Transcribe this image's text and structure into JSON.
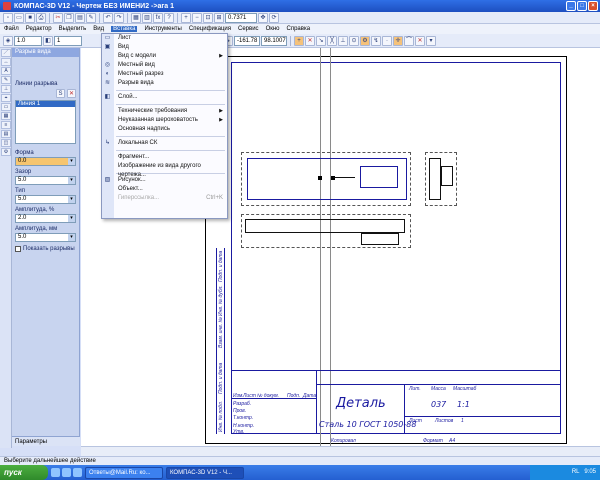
{
  "window": {
    "title": "КОМПАС-3D V12 - Чертеж БЕЗ ИМЕНИ2 ->ага 1"
  },
  "menubar": [
    "Файл",
    "Редактор",
    "Выделить",
    "Вид",
    "Вставка",
    "Инструменты",
    "Спецификация",
    "Сервис",
    "Окно",
    "Справка"
  ],
  "toolbar": {
    "zoom": "0.7371",
    "coord_x": "-161.78",
    "coord_y": "98.1007",
    "scale": "1.0",
    "layer": "1"
  },
  "panel": {
    "title": "Разрыв вида",
    "list_title": "Линии разрыва",
    "list_items": [
      "Линия 1"
    ],
    "form_label": "Форма",
    "form_value": "0.0",
    "gap_label": "Зазор",
    "gap_value": "5.0",
    "type_label": "Тип",
    "type_value": "5.0",
    "amp_label": "Амплитуда, %",
    "amp_value": "2.0",
    "amp_max_label": "Амплитуда, мм",
    "amp_max_value": "5.0",
    "show_label": "Показать разрывы",
    "tab_label": "Параметры"
  },
  "menu": {
    "items": [
      {
        "label": "Лист",
        "icon": "sheet-icon"
      },
      {
        "label": "Вид",
        "icon": "view-icon"
      },
      {
        "label": "Вид с модели",
        "icon": "",
        "submenu": true
      },
      {
        "label": "Местный вид",
        "icon": "local-view-icon"
      },
      {
        "label": "Местный разрез",
        "icon": "local-cut-icon"
      },
      {
        "label": "Разрыв вида",
        "icon": "view-break-icon"
      },
      {
        "sep": true
      },
      {
        "label": "Слой...",
        "icon": "layer-icon"
      },
      {
        "sep": true
      },
      {
        "label": "Технические требования",
        "icon": "",
        "submenu": true
      },
      {
        "label": "Неуказанная шероховатость",
        "icon": "",
        "submenu": true
      },
      {
        "label": "Основная надпись",
        "icon": ""
      },
      {
        "sep": true
      },
      {
        "label": "Локальная СК",
        "icon": "local-cs-icon"
      },
      {
        "sep": true
      },
      {
        "label": "Фрагмент...",
        "icon": ""
      },
      {
        "label": "Изображение из вида другого чертежа...",
        "icon": ""
      },
      {
        "sep": true
      },
      {
        "label": "Рисунок...",
        "icon": "picture-icon"
      },
      {
        "label": "Объект...",
        "icon": ""
      },
      {
        "label": "Гиперссылка...",
        "icon": "",
        "shortcut": "Ctrl+K",
        "disabled": true
      }
    ]
  },
  "stamp": {
    "name": "Деталь",
    "material": "Сталь 10  ГОСТ 1050-88",
    "mass": "037",
    "scale": "1:1",
    "col_lit": "Лит.",
    "col_mass": "Масса",
    "col_scale": "Масштаб",
    "sheet_label": "Лист",
    "sheets_label": "Листов",
    "sheets_count": "1",
    "copied": "Копировал",
    "format": "Формат",
    "format_value": "A4",
    "rows": [
      "Разраб.",
      "Пров.",
      "Т.контр.",
      "Н.контр.",
      "Утв."
    ],
    "headers": [
      "Изм.",
      "Лист",
      "№ докум.",
      "Подп.",
      "Дата"
    ],
    "side_labels": [
      "Подп. и дата",
      "Инв. № дубл.",
      "Взам. инв. №",
      "Подп. и дата",
      "Инв. № подл."
    ]
  },
  "status": {
    "text": "Выберите дальнейшее действие"
  },
  "taskbar": {
    "start": "пуск",
    "tasks": [
      "Ответы@Mail.Ru: ко...",
      "КОМПАС-3D V12 - Ч..."
    ],
    "tray_lang": "RL",
    "time": "9:05"
  }
}
